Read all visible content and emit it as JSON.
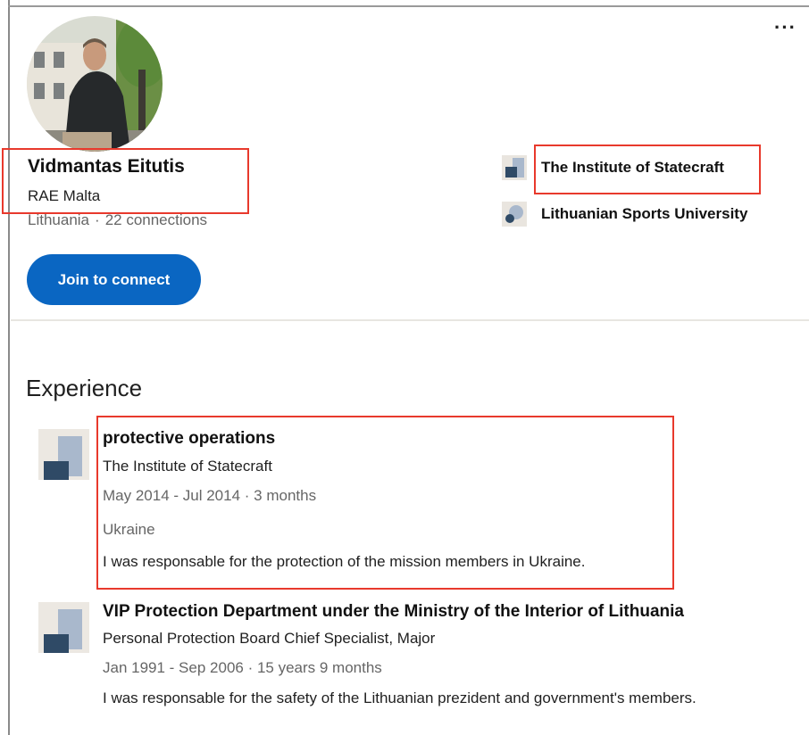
{
  "profile": {
    "name": "Vidmantas Eitutis",
    "headline": "RAE Malta",
    "location": "Lithuania",
    "separator": "·",
    "connections": "22 connections",
    "join_button": "Join to connect",
    "more_menu": "···",
    "organizations": [
      {
        "name": "The Institute of Statecraft",
        "icon": "company-logo-icon"
      },
      {
        "name": "Lithuanian Sports University",
        "icon": "school-logo-icon"
      }
    ]
  },
  "experience": {
    "title": "Experience",
    "items": [
      {
        "role": "protective operations",
        "company": "The Institute of Statecraft",
        "dates": "May 2014 - Jul 2014 · 3 months",
        "location": "Ukraine",
        "description": "I was responsable for the protection of the mission members in Ukraine."
      },
      {
        "role": "VIP Protection Department under the Ministry of the Interior of Lithuania",
        "company": "Personal Protection Board Chief Specialist, Major",
        "dates": "Jan 1991 - Sep 2006 · 15 years 9 months",
        "description": "I was responsable for the safety of the Lithuanian prezident and government's members."
      }
    ]
  },
  "colors": {
    "primary": "#0a66c2",
    "highlight": "#e8392c",
    "muted_text": "#666666"
  }
}
